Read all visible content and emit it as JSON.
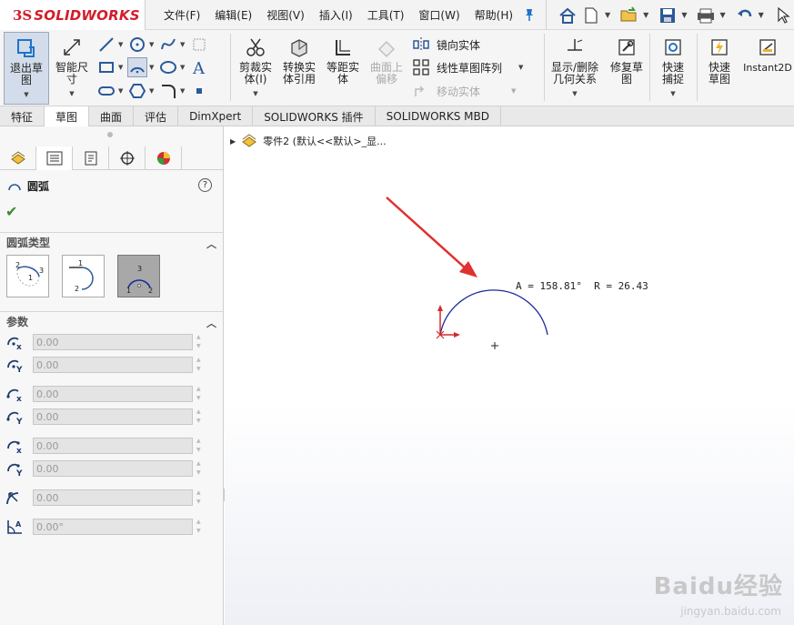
{
  "app": {
    "logo_ds": "3S",
    "logo_brand": "SOLIDWORKS"
  },
  "menu": [
    "文件(F)",
    "编辑(E)",
    "视图(V)",
    "插入(I)",
    "工具(T)",
    "窗口(W)",
    "帮助(H)"
  ],
  "quick_access": [
    "home-icon",
    "new-document-icon",
    "open-icon",
    "save-icon",
    "print-icon",
    "undo-icon",
    "select-icon"
  ],
  "commands": {
    "exit_sketch": "退出草图",
    "smart_dimension": "智能尺寸",
    "trim": "剪裁实体(I)",
    "convert": "转换实体引用",
    "offset": "等距实体",
    "offset_surface": "曲面上偏移",
    "mirror": "镜向实体",
    "linear_pattern": "线性草图阵列",
    "move": "移动实体",
    "display_relations": "显示/删除几何关系",
    "repair": "修复草图",
    "quick_snaps": "快速捕捉",
    "rapid_sketch": "快速草图",
    "instant2d": "Instant2D"
  },
  "tabs": [
    "特征",
    "草图",
    "曲面",
    "评估",
    "DimXpert",
    "SOLIDWORKS 插件",
    "SOLIDWORKS MBD"
  ],
  "active_tab": "草图",
  "panel": {
    "title": "圆弧",
    "arc_type_header": "圆弧类型",
    "params_header": "参数",
    "fields": [
      {
        "icon": "center-x-icon",
        "value": "0.00"
      },
      {
        "icon": "center-y-icon",
        "value": "0.00"
      },
      {
        "icon": "start-x-icon",
        "value": "0.00"
      },
      {
        "icon": "start-y-icon",
        "value": "0.00"
      },
      {
        "icon": "end-x-icon",
        "value": "0.00"
      },
      {
        "icon": "end-y-icon",
        "value": "0.00"
      },
      {
        "icon": "radius-icon",
        "value": "0.00"
      },
      {
        "icon": "angle-icon",
        "value": "0.00°"
      }
    ]
  },
  "tree": {
    "label": "零件2 (默认<<默认>_显..."
  },
  "sketch": {
    "dimension_label": "A = 158.81°  R = 26.43",
    "arc_color": "#1a2a9c",
    "arrow_color": "#e03030",
    "origin_color": "#d42a2a"
  },
  "watermark": {
    "text": "Baidu经验",
    "url": "jingyan.baidu.com"
  }
}
